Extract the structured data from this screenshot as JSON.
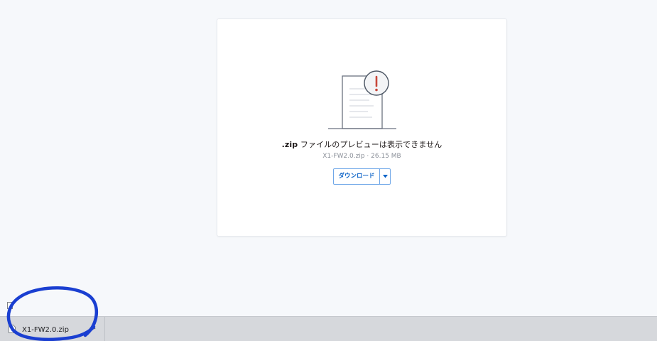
{
  "preview": {
    "title_ext": ".zip",
    "title_rest": " ファイルのプレビューは表示できません",
    "file_meta": "X1-FW2.0.zip · 26.15 MB",
    "download_label": "ダウンロード",
    "menu_icon": "caret-down-icon",
    "illustration_icon": "file-warning-icon"
  },
  "download_bar": {
    "file_name": "X1-FW2.0.zip",
    "options_icon": "chevron-up-icon",
    "file_icon": "file-icon"
  },
  "colors": {
    "accent": "#0d64c8",
    "annotation": "#1a3fd1",
    "warning": "#c8473a"
  }
}
